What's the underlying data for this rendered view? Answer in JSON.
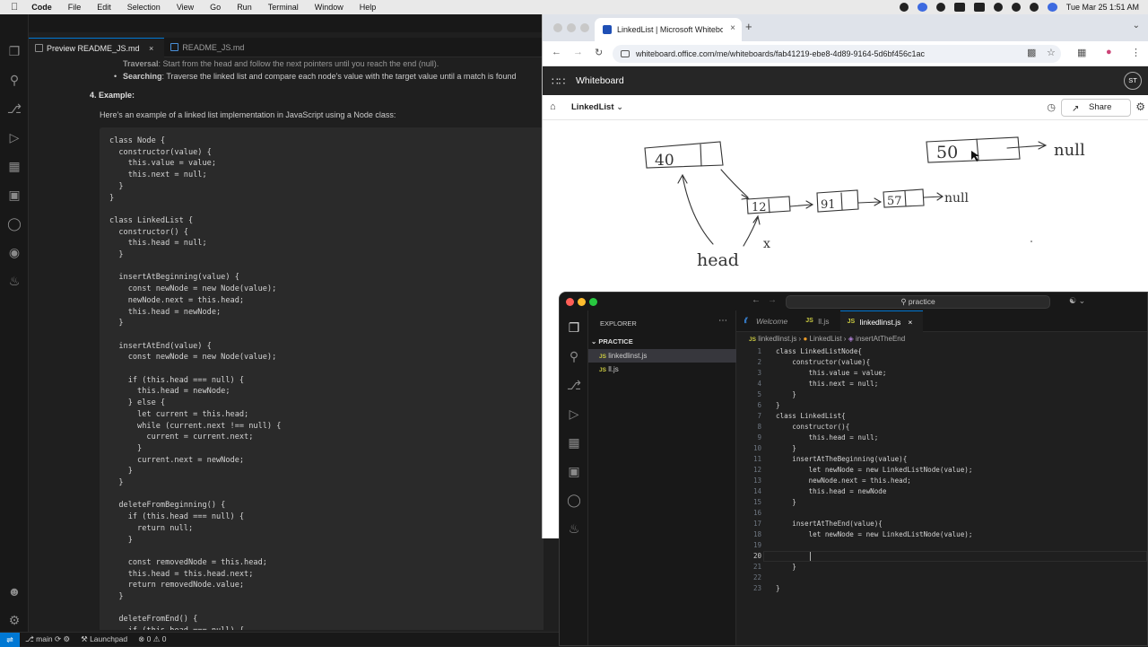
{
  "menubar": {
    "app": "Code",
    "items": [
      "File",
      "Edit",
      "Selection",
      "View",
      "Go",
      "Run",
      "Terminal",
      "Window",
      "Help"
    ],
    "datetime": "Tue Mar 25  1:51 AM"
  },
  "back_editor": {
    "tabs": [
      "Preview README_JS.md",
      "README_JS.md"
    ],
    "preview": {
      "traversal_bold": "Traversal",
      "traversal_text": ": Start from the head and follow the next pointers until you reach the end (null).",
      "searching_bold": "Searching",
      "searching_text": ": Traverse the linked list and compare each node's value with the target value until a match is found",
      "example_heading": "4. Example:",
      "example_intro": "Here's an example of a linked list implementation in JavaScript using a Node class:",
      "code_lines": [
        "class Node {",
        "  constructor(value) {",
        "    this.value = value;",
        "    this.next = null;",
        "  }",
        "}",
        "",
        "class LinkedList {",
        "  constructor() {",
        "    this.head = null;",
        "  }",
        "",
        "  insertAtBeginning(value) {",
        "    const newNode = new Node(value);",
        "    newNode.next = this.head;",
        "    this.head = newNode;",
        "  }",
        "",
        "  insertAtEnd(value) {",
        "    const newNode = new Node(value);",
        "",
        "    if (this.head === null) {",
        "      this.head = newNode;",
        "    } else {",
        "      let current = this.head;",
        "      while (current.next !== null) {",
        "        current = current.next;",
        "      }",
        "      current.next = newNode;",
        "    }",
        "  }",
        "",
        "  deleteFromBeginning() {",
        "    if (this.head === null) {",
        "      return null;",
        "    }",
        "",
        "    const removedNode = this.head;",
        "    this.head = this.head.next;",
        "    return removedNode.value;",
        "  }",
        "",
        "  deleteFromEnd() {",
        "    if (this.head === null) {"
      ]
    },
    "status": {
      "branch": "main",
      "launchpad": "Launchpad",
      "problems": "0",
      "warnings": "0"
    }
  },
  "browser": {
    "tab_title": "LinkedList | Microsoft Whiteboard",
    "url": "whiteboard.office.com/me/whiteboards/fab41219-ebe8-4d89-9164-5d6bf456c1ac",
    "app_name": "Whiteboard",
    "avatar": "ST",
    "board_name": "LinkedList",
    "share_label": "Share",
    "sketch": {
      "node1": "40",
      "node2": "12",
      "node3": "91",
      "node4": "57",
      "null1": "null",
      "node5": "50",
      "null2": "null",
      "head": "head",
      "x": "x"
    }
  },
  "front_editor": {
    "search": "practice",
    "explorer_title": "EXPLORER",
    "folder": "PRACTICE",
    "files": [
      "linkedlinst.js",
      "ll.js"
    ],
    "tabs": [
      "Welcome",
      "ll.js",
      "linkedlinst.js"
    ],
    "breadcrumb": [
      "linkedlinst.js",
      "LinkedList",
      "insertAtTheEnd"
    ],
    "current_line": 20,
    "code_lines": [
      "class LinkedListNode{",
      "    constructor(value){",
      "        this.value = value;",
      "        this.next = null;",
      "    }",
      "}",
      "class LinkedList{",
      "    constructor(){",
      "        this.head = null;",
      "    }",
      "    insertAtTheBeginning(value){",
      "        let newNode = new LinkedListNode(value);",
      "        newNode.next = this.head;",
      "        this.head = newNode",
      "    }",
      "",
      "    insertAtTheEnd(value){",
      "        let newNode = new LinkedListNode(value);",
      "",
      "        ",
      "    }",
      "",
      "}"
    ]
  }
}
